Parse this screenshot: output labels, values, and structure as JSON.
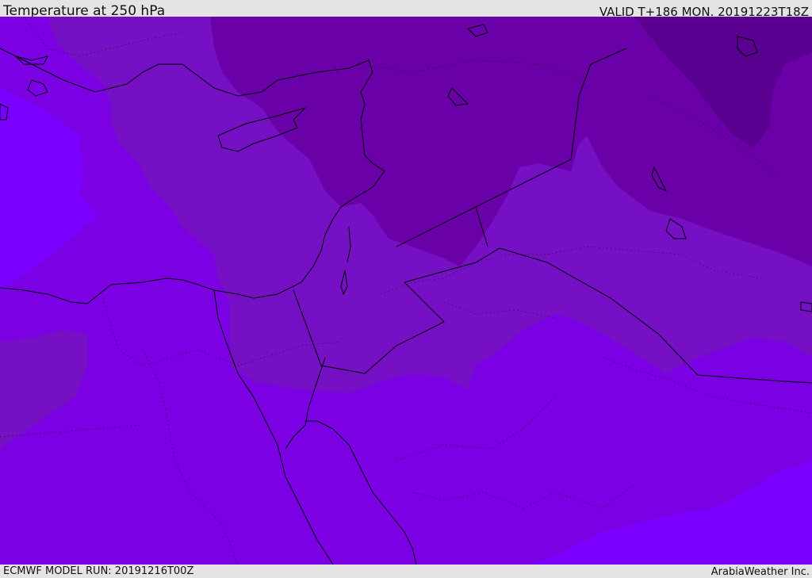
{
  "header": {
    "title": "Temperature at 250 hPa",
    "valid": "VALID T+186 MON. 20191223T18Z"
  },
  "footer": {
    "model_run": "ECMWF MODEL RUN: 20191216T00Z",
    "brand": "ArabiaWeather Inc."
  },
  "map": {
    "field": "temperature",
    "pressure_level": "250 hPa",
    "legend_shown": false,
    "fill_colors": {
      "warmest_band": "#7a00ff",
      "band_2": "#7c00e4",
      "band_3": "#7510c4",
      "band_4": "#6a00a8",
      "coldest_band": "#5a0090"
    },
    "line_colors": {
      "coastline": "#000000",
      "border": "#1a1a1a"
    }
  }
}
